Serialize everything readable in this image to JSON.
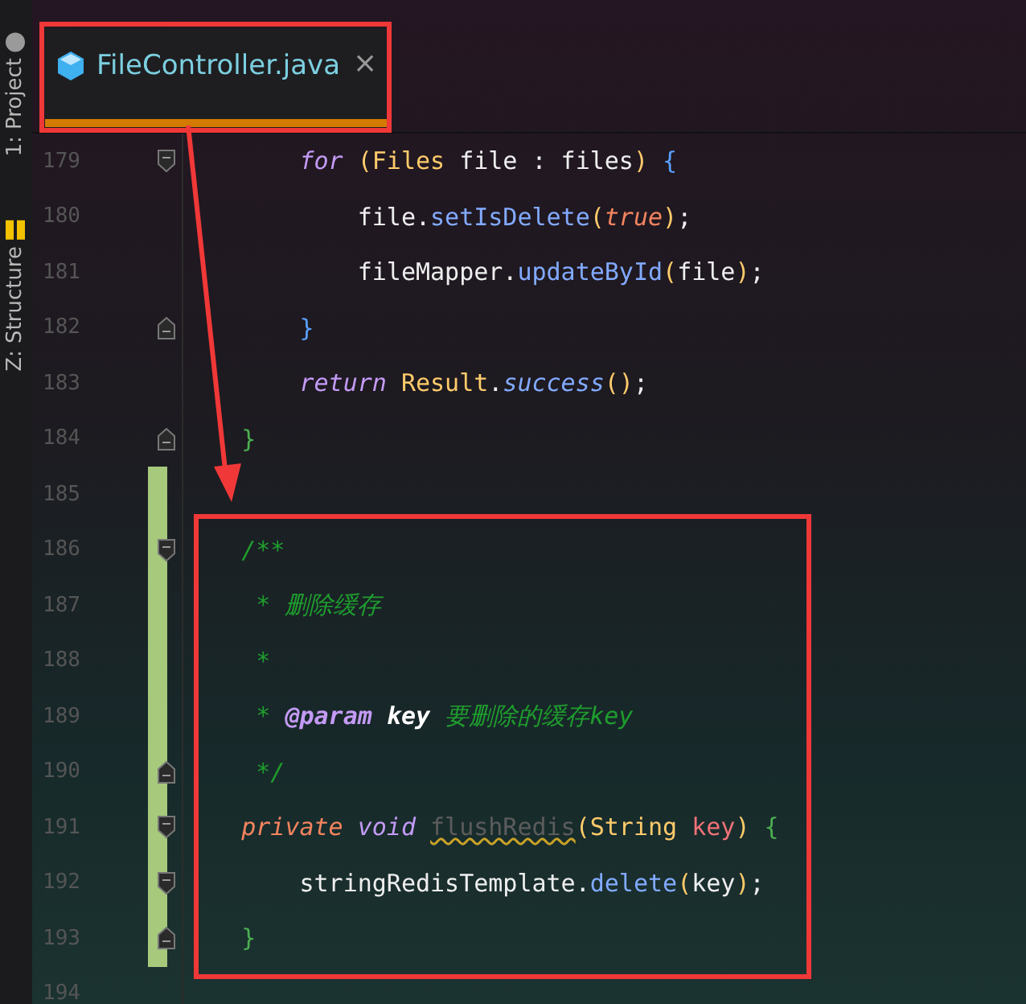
{
  "tool_windows": [
    {
      "label": "1: Project",
      "kind": "project"
    },
    {
      "label": "Z: Structure",
      "kind": "structure"
    }
  ],
  "tabs": [
    {
      "label": "FileController.java",
      "close": "×",
      "selected": true
    }
  ],
  "lines": [
    {
      "number": "179",
      "fold_start": true,
      "fold_end": false,
      "changed": false,
      "tokens": [
        {
          "text": "        for ",
          "kind": "keyword"
        },
        {
          "text": "(",
          "kind": "paren"
        },
        {
          "text": "Files",
          "kind": "type"
        },
        {
          "text": " file : files",
          "kind": "plain"
        },
        {
          "text": ") ",
          "kind": "paren"
        },
        {
          "text": "{",
          "kind": "brace"
        }
      ]
    },
    {
      "number": "180",
      "fold_start": false,
      "fold_end": false,
      "changed": false,
      "tokens": [
        {
          "text": "            file.",
          "kind": "plain"
        },
        {
          "text": "setIsDelete",
          "kind": "method"
        },
        {
          "text": "(",
          "kind": "paren"
        },
        {
          "text": "true",
          "kind": "literal"
        },
        {
          "text": ")",
          "kind": "paren"
        },
        {
          "text": ";",
          "kind": "plain"
        }
      ]
    },
    {
      "number": "181",
      "fold_start": false,
      "fold_end": false,
      "changed": false,
      "tokens": [
        {
          "text": "            fileMapper.",
          "kind": "plain"
        },
        {
          "text": "updateById",
          "kind": "method"
        },
        {
          "text": "(",
          "kind": "paren"
        },
        {
          "text": "file",
          "kind": "plain"
        },
        {
          "text": ")",
          "kind": "paren"
        },
        {
          "text": ";",
          "kind": "plain"
        }
      ]
    },
    {
      "number": "182",
      "fold_start": false,
      "fold_end": true,
      "changed": false,
      "tokens": [
        {
          "text": "        }",
          "kind": "brace"
        }
      ]
    },
    {
      "number": "183",
      "fold_start": false,
      "fold_end": false,
      "changed": false,
      "tokens": [
        {
          "text": "        return ",
          "kind": "keyword"
        },
        {
          "text": "Result",
          "kind": "type"
        },
        {
          "text": ".",
          "kind": "plain"
        },
        {
          "text": "success",
          "kind": "static"
        },
        {
          "text": "()",
          "kind": "paren"
        },
        {
          "text": ";",
          "kind": "plain"
        }
      ]
    },
    {
      "number": "184",
      "fold_start": false,
      "fold_end": true,
      "changed": false,
      "tokens": [
        {
          "text": "    }",
          "kind": "outer-brace"
        }
      ]
    },
    {
      "number": "185",
      "fold_start": false,
      "fold_end": false,
      "changed": true
    },
    {
      "number": "186",
      "fold_start": true,
      "fold_end": false,
      "changed": true,
      "tokens": [
        {
          "text": "    /**",
          "kind": "comment"
        }
      ]
    },
    {
      "number": "187",
      "fold_start": false,
      "fold_end": false,
      "changed": true,
      "tokens": [
        {
          "text": "     * 删除缓存",
          "kind": "comment"
        }
      ]
    },
    {
      "number": "188",
      "fold_start": false,
      "fold_end": false,
      "changed": true,
      "tokens": [
        {
          "text": "     *",
          "kind": "comment"
        }
      ]
    },
    {
      "number": "189",
      "fold_start": false,
      "fold_end": false,
      "changed": true,
      "tokens": [
        {
          "text": "     * ",
          "kind": "comment"
        },
        {
          "text": "@param ",
          "kind": "doc-tag"
        },
        {
          "text": "key ",
          "kind": "doc-param"
        },
        {
          "text": "要删除的缓存key",
          "kind": "comment"
        }
      ]
    },
    {
      "number": "190",
      "fold_start": false,
      "fold_end": true,
      "changed": true,
      "tokens": [
        {
          "text": "     */",
          "kind": "comment"
        }
      ]
    },
    {
      "number": "191",
      "fold_start": true,
      "fold_end": false,
      "changed": true,
      "tokens": [
        {
          "text": "    private ",
          "kind": "modifier"
        },
        {
          "text": "void ",
          "kind": "keyword"
        },
        {
          "text": "flushRedis",
          "kind": "unused"
        },
        {
          "text": "(",
          "kind": "paren"
        },
        {
          "text": "String ",
          "kind": "type"
        },
        {
          "text": "key",
          "kind": "param"
        },
        {
          "text": ") ",
          "kind": "paren"
        },
        {
          "text": "{",
          "kind": "outer-brace"
        }
      ]
    },
    {
      "number": "192",
      "fold_start": true,
      "fold_end": false,
      "changed": true,
      "tokens": [
        {
          "text": "        stringRedisTemplate.",
          "kind": "plain"
        },
        {
          "text": "delete",
          "kind": "method"
        },
        {
          "text": "(",
          "kind": "paren"
        },
        {
          "text": "key",
          "kind": "plain"
        },
        {
          "text": ")",
          "kind": "paren"
        },
        {
          "text": ";",
          "kind": "plain"
        }
      ]
    },
    {
      "number": "193",
      "fold_start": false,
      "fold_end": true,
      "changed": true,
      "tokens": [
        {
          "text": "    }",
          "kind": "outer-brace"
        }
      ]
    },
    {
      "number": "194",
      "fold_start": false,
      "fold_end": false,
      "changed": false
    }
  ]
}
